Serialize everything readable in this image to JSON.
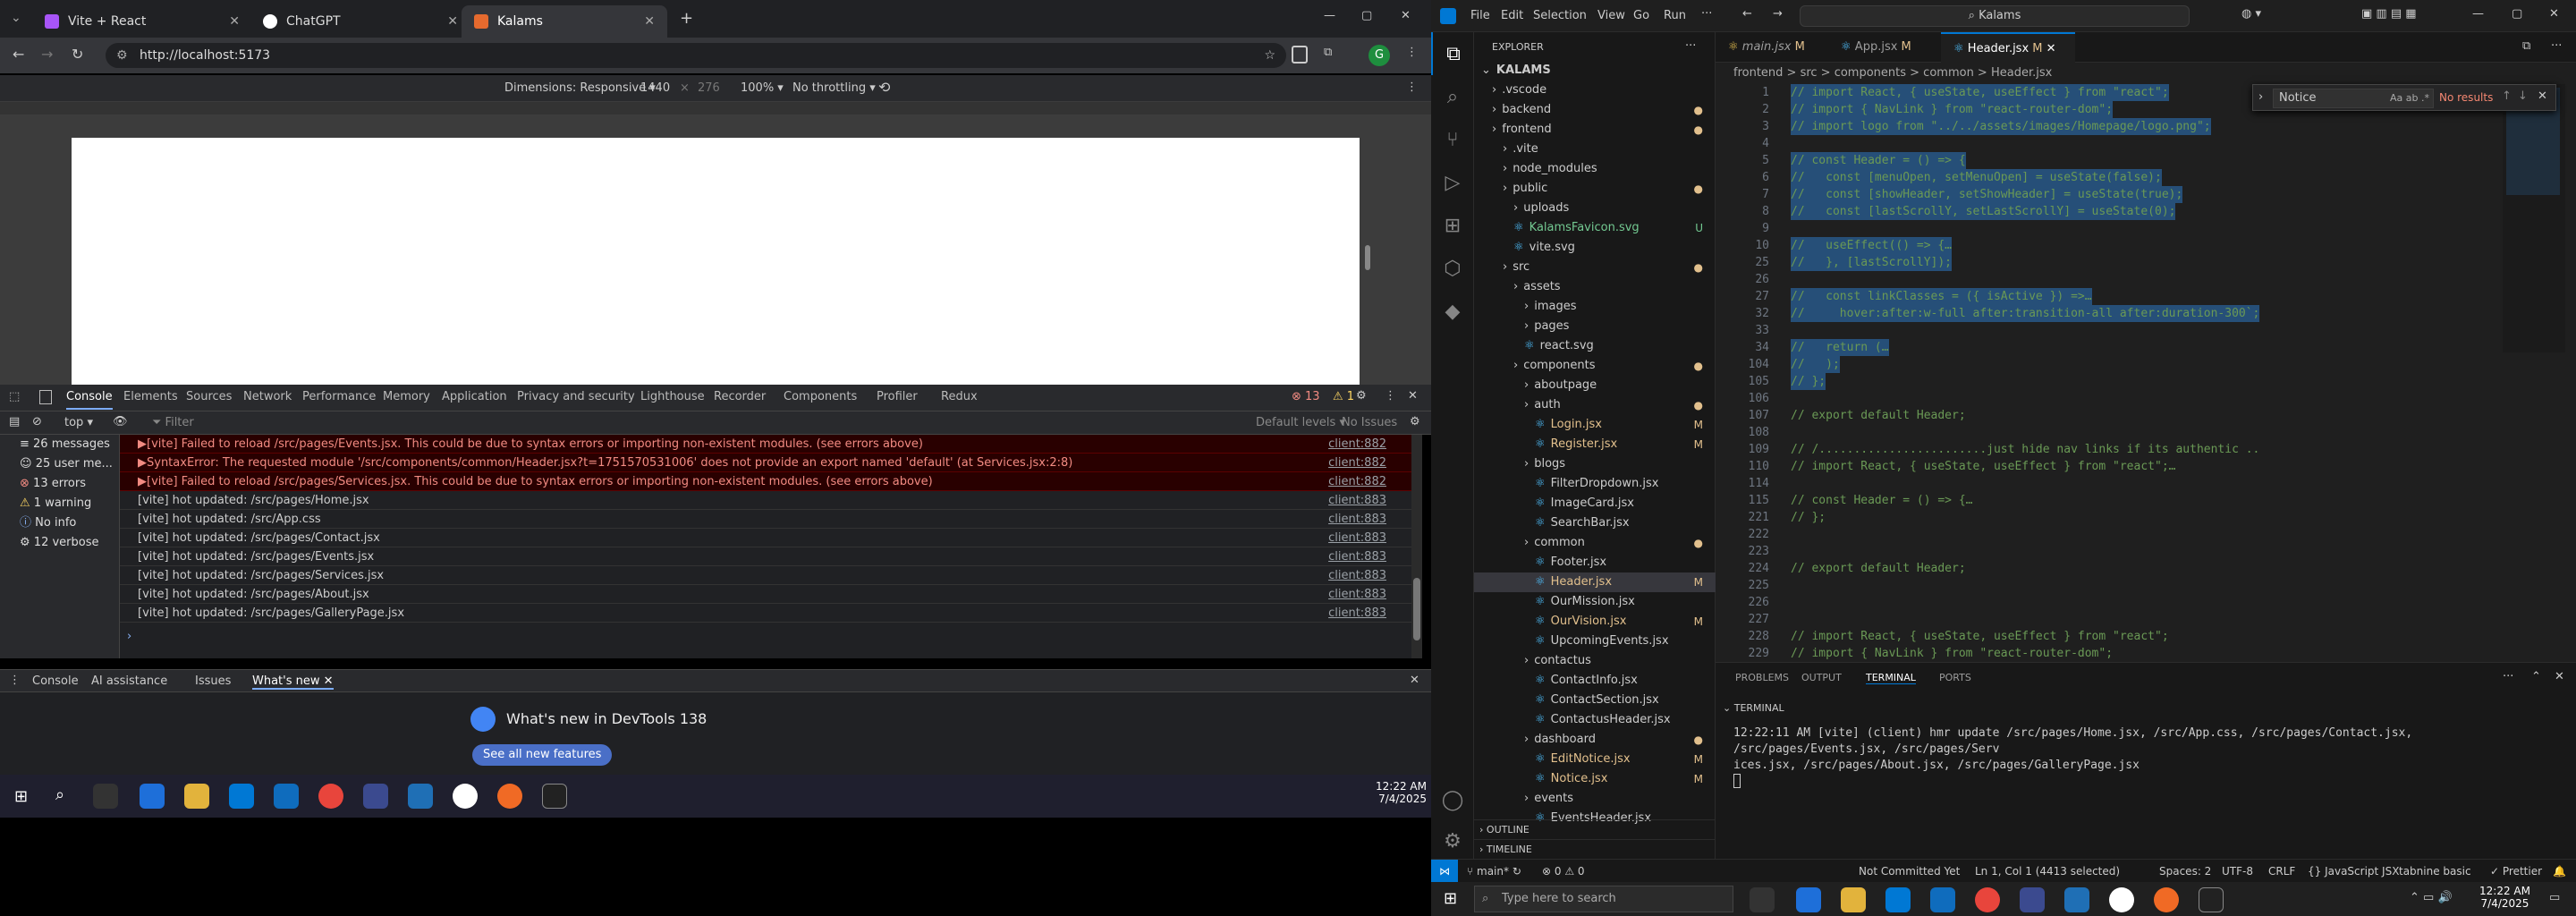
{
  "chrome": {
    "tabs": [
      {
        "title": "Vite + React"
      },
      {
        "title": "ChatGPT"
      },
      {
        "title": "Kalams"
      }
    ],
    "url": "http://localhost:5173",
    "profile_initial": "G"
  },
  "device_toolbar": {
    "dimensions_label": "Dimensions: Responsive",
    "width": "1440",
    "height": "276",
    "zoom": "100%",
    "throttle": "No throttling"
  },
  "devtools": {
    "tabs": [
      "Console",
      "Elements",
      "Sources",
      "Network",
      "Performance",
      "Memory",
      "Application",
      "Privacy and security",
      "Lighthouse",
      "Recorder",
      "Components",
      "Profiler",
      "Redux"
    ],
    "error_count": "13",
    "warn_count": "1",
    "context": "top",
    "filter_placeholder": "Filter",
    "levels": "Default levels",
    "issues": "No Issues",
    "sidebar": [
      {
        "label": "26 messages"
      },
      {
        "label": "25 user me..."
      },
      {
        "label": "13 errors"
      },
      {
        "label": "1 warning"
      },
      {
        "label": "No info"
      },
      {
        "label": "12 verbose"
      }
    ],
    "log": [
      {
        "type": "err",
        "text": "▶[vite] Failed to reload /src/pages/Events.jsx. This could be due to syntax errors or importing non-existent modules. (see errors above)",
        "src": "client:882"
      },
      {
        "type": "err",
        "text": "▶SyntaxError: The requested module '/src/components/common/Header.jsx?t=1751570531006' does not provide an export named 'default' (at Services.jsx:2:8)",
        "src": "client:882"
      },
      {
        "type": "err",
        "text": "▶[vite] Failed to reload /src/pages/Services.jsx. This could be due to syntax errors or importing non-existent modules. (see errors above)",
        "src": "client:882"
      },
      {
        "type": "info",
        "text": "[vite] hot updated: /src/pages/Home.jsx",
        "src": "client:883"
      },
      {
        "type": "info",
        "text": "[vite] hot updated: /src/App.css",
        "src": "client:883"
      },
      {
        "type": "info",
        "text": "[vite] hot updated: /src/pages/Contact.jsx",
        "src": "client:883"
      },
      {
        "type": "info",
        "text": "[vite] hot updated: /src/pages/Events.jsx",
        "src": "client:883"
      },
      {
        "type": "info",
        "text": "[vite] hot updated: /src/pages/Services.jsx",
        "src": "client:883"
      },
      {
        "type": "info",
        "text": "[vite] hot updated: /src/pages/About.jsx",
        "src": "client:883"
      },
      {
        "type": "info",
        "text": "[vite] hot updated: /src/pages/GalleryPage.jsx",
        "src": "client:883"
      }
    ],
    "drawer_tabs": [
      "Console",
      "AI assistance",
      "Issues",
      "What's new"
    ],
    "whats_new_title": "What's new in DevTools 138",
    "see_all": "See all new features"
  },
  "left_clock": {
    "time": "12:22 AM",
    "date": "7/4/2025"
  },
  "vscode": {
    "menu": [
      "File",
      "Edit",
      "Selection",
      "View",
      "Go",
      "Run"
    ],
    "search": "Kalams",
    "explorer_title": "EXPLORER",
    "tabs": [
      {
        "name": "main.jsx",
        "status": "M"
      },
      {
        "name": "App.jsx",
        "status": "M"
      },
      {
        "name": "Header.jsx",
        "status": "M"
      }
    ],
    "breadcrumb": "frontend > src > components > common > Header.jsx",
    "find_value": "Notice",
    "find_result": "No results",
    "tree": [
      {
        "label": "KALAMS",
        "depth": 0,
        "type": "root",
        "status": ""
      },
      {
        "label": ".vscode",
        "depth": 1,
        "type": "folder",
        "status": ""
      },
      {
        "label": "backend",
        "depth": 1,
        "type": "folder",
        "status": "●"
      },
      {
        "label": "frontend",
        "depth": 1,
        "type": "folder",
        "status": "●"
      },
      {
        "label": ".vite",
        "depth": 2,
        "type": "folder",
        "status": ""
      },
      {
        "label": "node_modules",
        "depth": 2,
        "type": "folder",
        "status": ""
      },
      {
        "label": "public",
        "depth": 2,
        "type": "folder",
        "status": "●"
      },
      {
        "label": "uploads",
        "depth": 3,
        "type": "folder",
        "status": ""
      },
      {
        "label": "KalamsFavicon.svg",
        "depth": 3,
        "type": "file",
        "status": "U"
      },
      {
        "label": "vite.svg",
        "depth": 3,
        "type": "file",
        "status": ""
      },
      {
        "label": "src",
        "depth": 2,
        "type": "folder",
        "status": "●"
      },
      {
        "label": "assets",
        "depth": 3,
        "type": "folder",
        "status": ""
      },
      {
        "label": "images",
        "depth": 4,
        "type": "folder",
        "status": ""
      },
      {
        "label": "pages",
        "depth": 4,
        "type": "folder",
        "status": ""
      },
      {
        "label": "react.svg",
        "depth": 4,
        "type": "file",
        "status": ""
      },
      {
        "label": "components",
        "depth": 3,
        "type": "folder",
        "status": "●"
      },
      {
        "label": "aboutpage",
        "depth": 4,
        "type": "folder",
        "status": ""
      },
      {
        "label": "auth",
        "depth": 4,
        "type": "folder",
        "status": "●"
      },
      {
        "label": "Login.jsx",
        "depth": 5,
        "type": "file",
        "status": "M"
      },
      {
        "label": "Register.jsx",
        "depth": 5,
        "type": "file",
        "status": "M"
      },
      {
        "label": "blogs",
        "depth": 4,
        "type": "folder",
        "status": ""
      },
      {
        "label": "FilterDropdown.jsx",
        "depth": 5,
        "type": "file",
        "status": ""
      },
      {
        "label": "ImageCard.jsx",
        "depth": 5,
        "type": "file",
        "status": ""
      },
      {
        "label": "SearchBar.jsx",
        "depth": 5,
        "type": "file",
        "status": ""
      },
      {
        "label": "common",
        "depth": 4,
        "type": "folder",
        "status": "●"
      },
      {
        "label": "Footer.jsx",
        "depth": 5,
        "type": "file",
        "status": ""
      },
      {
        "label": "Header.jsx",
        "depth": 5,
        "type": "file",
        "status": "M"
      },
      {
        "label": "OurMission.jsx",
        "depth": 5,
        "type": "file",
        "status": ""
      },
      {
        "label": "OurVision.jsx",
        "depth": 5,
        "type": "file",
        "status": "M"
      },
      {
        "label": "UpcomingEvents.jsx",
        "depth": 5,
        "type": "file",
        "status": ""
      },
      {
        "label": "contactus",
        "depth": 4,
        "type": "folder",
        "status": ""
      },
      {
        "label": "ContactInfo.jsx",
        "depth": 5,
        "type": "file",
        "status": ""
      },
      {
        "label": "ContactSection.jsx",
        "depth": 5,
        "type": "file",
        "status": ""
      },
      {
        "label": "ContactusHeader.jsx",
        "depth": 5,
        "type": "file",
        "status": ""
      },
      {
        "label": "dashboard",
        "depth": 4,
        "type": "folder",
        "status": "●"
      },
      {
        "label": "EditNotice.jsx",
        "depth": 5,
        "type": "file",
        "status": "M"
      },
      {
        "label": "Notice.jsx",
        "depth": 5,
        "type": "file",
        "status": "M"
      },
      {
        "label": "events",
        "depth": 4,
        "type": "folder",
        "status": ""
      },
      {
        "label": "EventsHeader.jsx",
        "depth": 5,
        "type": "file",
        "status": ""
      }
    ],
    "outline": "OUTLINE",
    "timeline": "TIMELINE",
    "code": [
      {
        "n": "1",
        "t": "// import React, { useState, useEffect } from \"react\";",
        "sel": true
      },
      {
        "n": "2",
        "t": "// import { NavLink } from \"react-router-dom\";",
        "sel": true
      },
      {
        "n": "3",
        "t": "// import logo from \"../../assets/images/Homepage/logo.png\";",
        "sel": true
      },
      {
        "n": "4",
        "t": "",
        "sel": true
      },
      {
        "n": "5",
        "t": "// const Header = () => {",
        "sel": true
      },
      {
        "n": "6",
        "t": "//   const [menuOpen, setMenuOpen] = useState(false);",
        "sel": true
      },
      {
        "n": "7",
        "t": "//   const [showHeader, setShowHeader] = useState(true);",
        "sel": true
      },
      {
        "n": "8",
        "t": "//   const [lastScrollY, setLastScrollY] = useState(0);",
        "sel": true
      },
      {
        "n": "9",
        "t": "",
        "sel": true
      },
      {
        "n": "10",
        "t": "//   useEffect(() => {…",
        "sel": true
      },
      {
        "n": "25",
        "t": "//   }, [lastScrollY]);",
        "sel": true
      },
      {
        "n": "26",
        "t": "",
        "sel": true
      },
      {
        "n": "27",
        "t": "//   const linkClasses = ({ isActive }) =>…",
        "sel": true
      },
      {
        "n": "32",
        "t": "//     hover:after:w-full after:transition-all after:duration-300`;",
        "sel": true
      },
      {
        "n": "33",
        "t": "",
        "sel": true
      },
      {
        "n": "34",
        "t": "//   return (…",
        "sel": true
      },
      {
        "n": "104",
        "t": "//   );",
        "sel": true
      },
      {
        "n": "105",
        "t": "// };",
        "sel": true
      },
      {
        "n": "106",
        "t": "",
        "sel": false
      },
      {
        "n": "107",
        "t": "// export default Header;",
        "sel": false
      },
      {
        "n": "108",
        "t": "",
        "sel": false
      },
      {
        "n": "109",
        "t": "// /........................just hide nav links if its authentic ..",
        "sel": false
      },
      {
        "n": "110",
        "t": "// import React, { useState, useEffect } from \"react\";…",
        "sel": false
      },
      {
        "n": "114",
        "t": "",
        "sel": false
      },
      {
        "n": "115",
        "t": "// const Header = () => {…",
        "sel": false
      },
      {
        "n": "221",
        "t": "// };",
        "sel": false
      },
      {
        "n": "222",
        "t": "",
        "sel": false
      },
      {
        "n": "223",
        "t": "",
        "sel": false
      },
      {
        "n": "224",
        "t": "// export default Header;",
        "sel": false
      },
      {
        "n": "225",
        "t": "",
        "sel": false
      },
      {
        "n": "226",
        "t": "",
        "sel": false
      },
      {
        "n": "227",
        "t": "",
        "sel": false
      },
      {
        "n": "228",
        "t": "// import React, { useState, useEffect } from \"react\";",
        "sel": false
      },
      {
        "n": "229",
        "t": "// import { NavLink } from \"react-router-dom\";",
        "sel": false
      }
    ],
    "panel_tabs": [
      "PROBLEMS",
      "OUTPUT",
      "TERMINAL",
      "PORTS"
    ],
    "terminal_label": "TERMINAL",
    "terminal_lines": [
      "12:22:11 AM [vite] (client) hmr update /src/pages/Home.jsx, /src/App.css, /src/pages/Contact.jsx, /src/pages/Events.jsx, /src/pages/Serv",
      "ices.jsx, /src/pages/About.jsx, /src/pages/GalleryPage.jsx"
    ],
    "status": {
      "branch": "main*",
      "problems": "⊗ 0 ⚠ 0",
      "not_committed": "Not Committed Yet",
      "position": "Ln 1, Col 1 (4413 selected)",
      "spaces": "Spaces: 2",
      "encoding": "UTF-8",
      "eol": "CRLF",
      "language": "{} JavaScript JSX",
      "tabnine": "tabnine basic",
      "prettier": "✓ Prettier"
    }
  },
  "right_taskbar": {
    "search_placeholder": "Type here to search",
    "time": "12:22 AM",
    "date": "7/4/2025"
  }
}
